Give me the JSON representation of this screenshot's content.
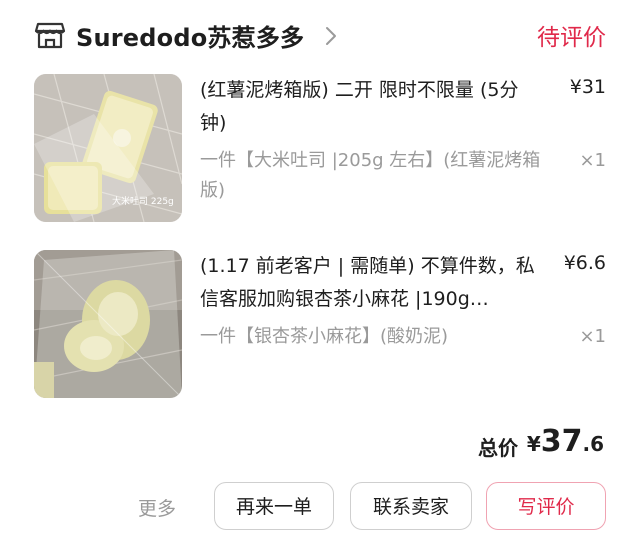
{
  "header": {
    "store_icon": "store-icon",
    "store_name": "Suredodo苏惹多多",
    "chevron_icon": "chevron-right-icon",
    "status": "待评价"
  },
  "products": [
    {
      "title": "(红薯泥烤箱版) 二开 限时不限量 (5分钟)",
      "price": "¥31",
      "spec": "一件【大米吐司 |205g 左右】(红薯泥烤箱版)",
      "quantity": "×1",
      "thumb_caption": "大米吐司 225g"
    },
    {
      "title": "(1.17 前老客户 | 需随单) 不算件数，私信客服加购银杏茶小麻花 |190g…",
      "price": "¥6.6",
      "spec": "一件【银杏茶小麻花】(酸奶泥)",
      "quantity": "×1"
    }
  ],
  "total": {
    "label": "总价",
    "currency": "¥",
    "integer": "37",
    "decimal": ".6"
  },
  "actions": {
    "more": "更多",
    "rebuy": "再来一单",
    "contact_seller": "联系卖家",
    "write_review": "写评价"
  },
  "colors": {
    "accent": "#e0294a",
    "muted_text": "#9a9a9a",
    "border": "#cfcfcf"
  }
}
